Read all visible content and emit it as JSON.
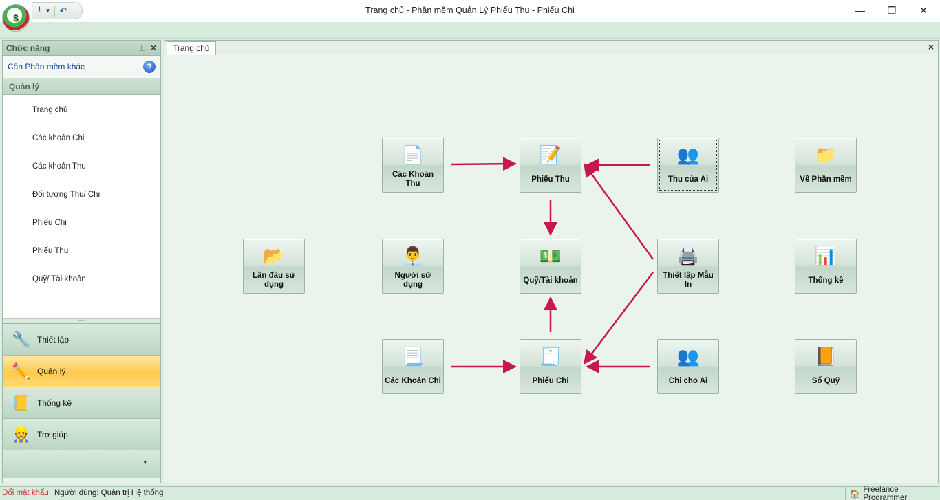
{
  "window": {
    "title": "Trang chủ - Phần mềm Quản Lý Phiếu Thu - Phiếu Chi",
    "minimize": "—",
    "restore": "❐",
    "close": "✕"
  },
  "quick_access": {
    "save_icon": "save-icon",
    "undo_icon": "undo-icon"
  },
  "left_panel": {
    "title": "Chức năng",
    "link": "Cần Phần mềm khác",
    "group": "Quản lý",
    "items": [
      "Trang chủ",
      "Các khoản Chi",
      "Các khoản Thu",
      "Đối tượng Thu/ Chi",
      "Phiếu Chi",
      "Phiếu Thu",
      "Quỹ/ Tài khoản"
    ],
    "nav": [
      {
        "label": "Thiết lập",
        "icon": "tools-icon"
      },
      {
        "label": "Quản lý",
        "icon": "pencil-icon"
      },
      {
        "label": "Thống kê",
        "icon": "report-icon"
      },
      {
        "label": "Trợ giúp",
        "icon": "support-icon"
      }
    ]
  },
  "main": {
    "tab": "Trang chủ",
    "tiles": {
      "cac_khoan_thu": "Các Khoản Thu",
      "phieu_thu": "Phiếu Thu",
      "thu_cua_ai": "Thu của Ai",
      "ve_phan_mem": "Về Phần mềm",
      "lan_dau": "Lần đầu sử dụng",
      "nguoi_su_dung": "Người sử dụng",
      "quy_tai_khoan": "Quỹ/Tài khoản",
      "thiet_lap_mau_in": "Thiết lập Mẫu In",
      "thong_ke": "Thống kê",
      "cac_khoan_chi": "Các Khoản Chi",
      "phieu_chi": "Phiếu Chi",
      "chi_cho_ai": "Chi cho Ai",
      "so_quy": "Sổ Quỹ"
    },
    "arrow_color": "#c8174a"
  },
  "status": {
    "password": "Đổi mật khẩu",
    "user": "Người dùng: Quản trị Hệ thống",
    "brand": "Freelance Programmer"
  }
}
